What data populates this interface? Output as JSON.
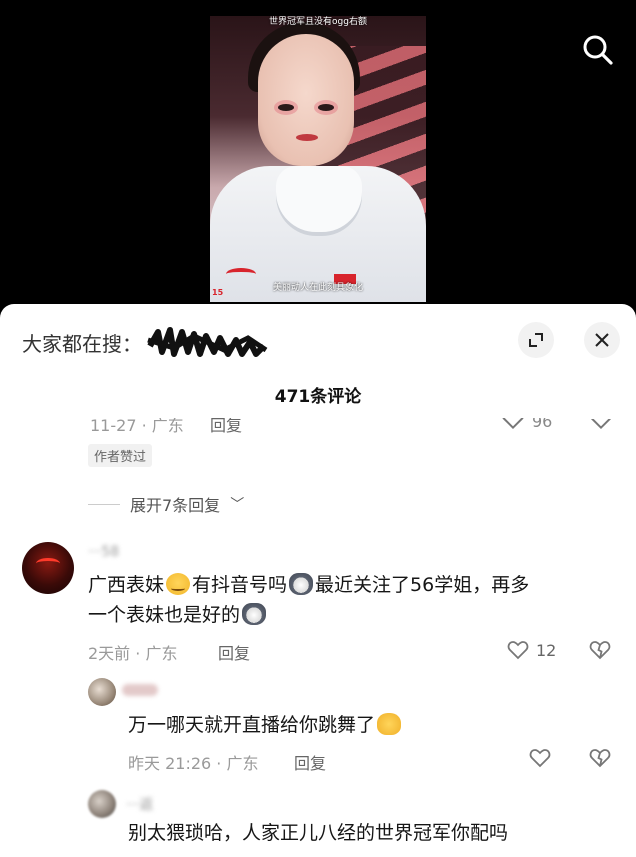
{
  "video": {
    "caption_top": "世界冠军且没有ogg右额",
    "caption_bottom": "美丽动人在此刻具象化",
    "corner_mark": "15"
  },
  "sheet": {
    "search_prefix": "大家都在搜：",
    "comment_count": "471条评论",
    "partial_comment": {
      "meta": "11-27 · 广东",
      "reply": "回复",
      "likes": "96",
      "author_tag": "作者赞过"
    },
    "expand_replies": "展开7条回复"
  },
  "comments": [
    {
      "username": "···58",
      "body_part1": "广西表妹",
      "body_part2": "有抖音号吗",
      "body_part3": "最近关注了56学姐，再多",
      "body_line2": "一个表妹也是好的",
      "time_location": "2天前 · 广东",
      "reply": "回复",
      "likes": "12"
    },
    {
      "body": "万一哪天就开直播给你跳舞了",
      "time_location": "昨天 21:26 · 广东",
      "reply": "回复",
      "likes": ""
    },
    {
      "username": "···返",
      "body": "别太猥琐哈，人家正儿八经的世界冠军你配吗",
      "time_location": "",
      "reply": "",
      "likes": ""
    }
  ],
  "colors": {
    "sheet_bg": "#ffffff",
    "video_bg": "#000000",
    "text_primary": "#161616",
    "text_muted": "#9a9a9a"
  },
  "icons": [
    "search-icon",
    "expand-icon",
    "close-icon",
    "heart-icon",
    "dislike-heart-icon",
    "chevron-down-icon"
  ]
}
